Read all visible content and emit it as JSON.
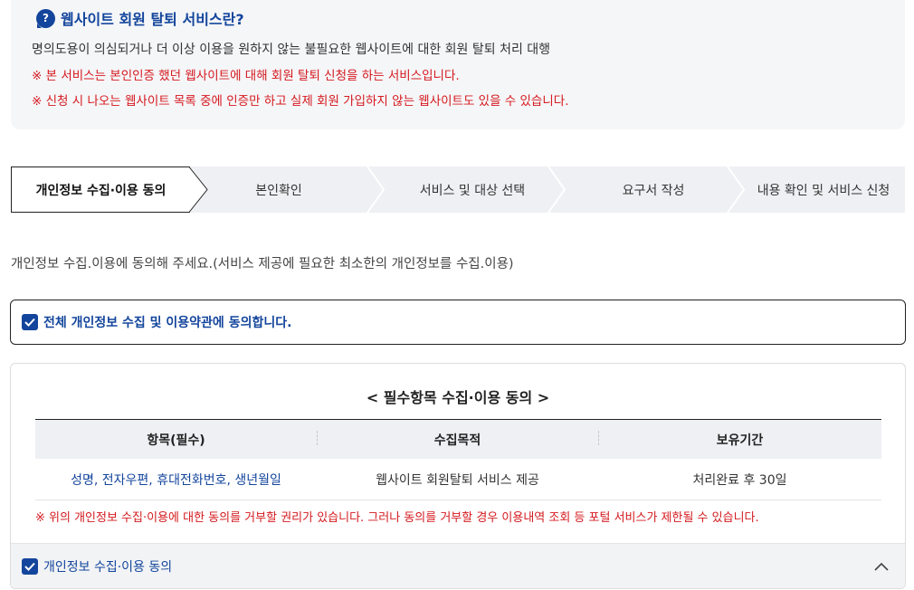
{
  "info": {
    "icon": "question-bubble-icon",
    "title": "웹사이트 회원 탈퇴 서비스란?",
    "description": "명의도용이 의심되거나 더 이상 이용을 원하지 않는 불필요한 웹사이트에 대한 회원 탈퇴 처리 대행",
    "note1": "※ 본 서비스는 본인인증 했던 웹사이트에 대해 회원 탈퇴 신청을 하는 서비스입니다.",
    "note2": "※ 신청 시 나오는 웹사이트 목록 중에 인증만 하고 실제 회원 가입하지 않는 웹사이트도 있을 수 있습니다."
  },
  "steps": [
    {
      "label": "개인정보 수집·이용 동의",
      "active": true
    },
    {
      "label": "본인확인",
      "active": false
    },
    {
      "label": "서비스 및 대상 선택",
      "active": false
    },
    {
      "label": "요구서 작성",
      "active": false
    },
    {
      "label": "내용 확인 및 서비스 신청",
      "active": false
    }
  ],
  "guide": "개인정보 수집.이용에 동의해 주세요.(서비스 제공에 필요한 최소한의 개인정보를 수집.이용)",
  "agree_all": {
    "label": "전체 개인정보 수집 및 이용약관에 동의합니다.",
    "checked": true
  },
  "terms": {
    "title": "< 필수항목 수집·이용 동의 >",
    "columns": [
      "항목(필수)",
      "수집목적",
      "보유기간"
    ],
    "rows": [
      [
        "성명, 전자우편, 휴대전화번호, 생년월일",
        "웹사이트 회원탈퇴 서비스 제공",
        "처리완료 후 30일"
      ]
    ],
    "note": "※ 위의 개인정보 수집·이용에 대한 동의를 거부할 권리가 있습니다. 그러나 동의를 거부할 경우 이용내역 조회 등 포털 서비스가 제한될 수 있습니다.",
    "footer_label": "개인정보 수집·이용 동의",
    "footer_checked": true,
    "toggle_icon": "chevron-up-icon"
  },
  "colors": {
    "accent": "#13459c",
    "warning": "#d5191e",
    "step_bg": "#eef0f3",
    "info_bg": "#f5f6f8"
  }
}
